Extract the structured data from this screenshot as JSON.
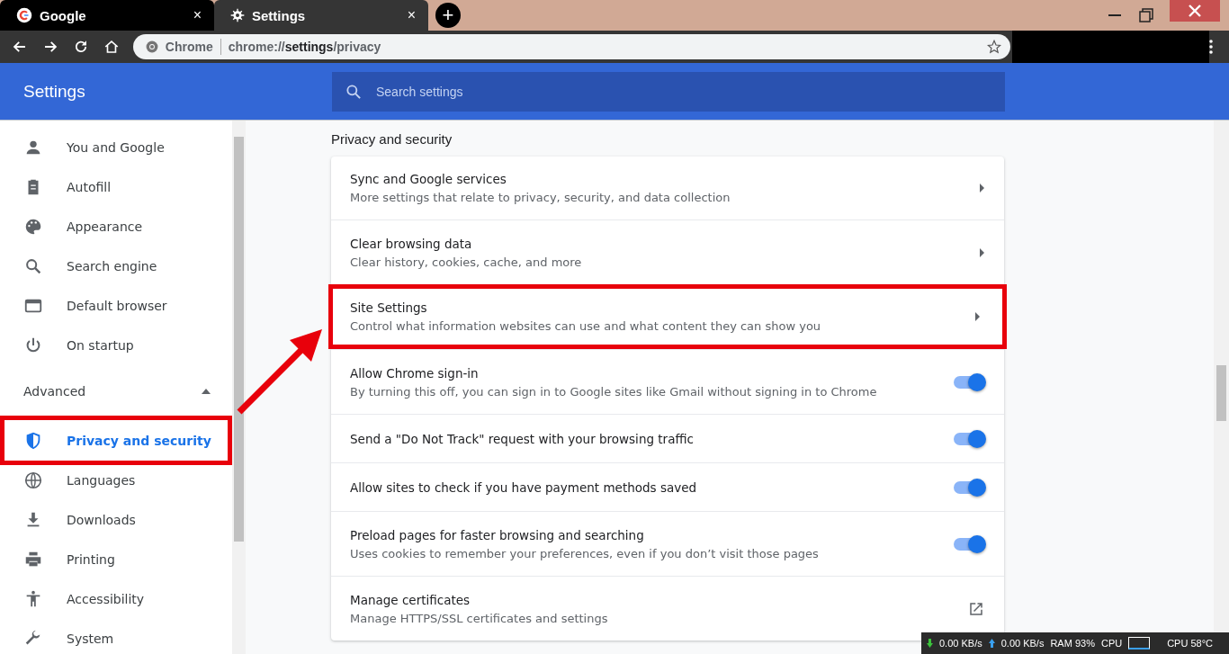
{
  "tabs": [
    {
      "title": "Google",
      "selected": false,
      "close": "×"
    },
    {
      "title": "Settings",
      "selected": true,
      "close": "×"
    }
  ],
  "new_tab": "+",
  "address_bar": {
    "site_label": "Chrome",
    "url_prefix": "chrome://",
    "url_bold": "settings",
    "url_suffix": "/privacy"
  },
  "header": {
    "title": "Settings",
    "search_placeholder": "Search settings"
  },
  "sidebar": {
    "items": [
      {
        "label": "You and Google",
        "selected": false,
        "highlighted": false
      },
      {
        "label": "Autofill",
        "selected": false,
        "highlighted": false
      },
      {
        "label": "Appearance",
        "selected": false,
        "highlighted": false
      },
      {
        "label": "Search engine",
        "selected": false,
        "highlighted": false
      },
      {
        "label": "Default browser",
        "selected": false,
        "highlighted": false
      },
      {
        "label": "On startup",
        "selected": false,
        "highlighted": false
      }
    ],
    "advanced": {
      "label": "Advanced",
      "expanded": true
    },
    "advanced_items": [
      {
        "label": "Privacy and security",
        "selected": true,
        "highlighted": true
      },
      {
        "label": "Languages",
        "selected": false,
        "highlighted": false
      },
      {
        "label": "Downloads",
        "selected": false,
        "highlighted": false
      },
      {
        "label": "Printing",
        "selected": false,
        "highlighted": false
      },
      {
        "label": "Accessibility",
        "selected": false,
        "highlighted": false
      },
      {
        "label": "System",
        "selected": false,
        "highlighted": false
      }
    ]
  },
  "section": {
    "title": "Privacy and security",
    "rows": [
      {
        "kind": "arrow",
        "title": "Sync and Google services",
        "subtitle": "More settings that relate to privacy, security, and data collection",
        "highlighted": false
      },
      {
        "kind": "arrow",
        "title": "Clear browsing data",
        "subtitle": "Clear history, cookies, cache, and more",
        "highlighted": false
      },
      {
        "kind": "arrow",
        "title": "Site Settings",
        "subtitle": "Control what information websites can use and what content they can show you",
        "highlighted": true
      },
      {
        "kind": "toggle",
        "title": "Allow Chrome sign-in",
        "subtitle": "By turning this off, you can sign in to Google sites like Gmail without signing in to Chrome",
        "on": true,
        "highlighted": false
      },
      {
        "kind": "toggle",
        "title": "Send a \"Do Not Track\" request with your browsing traffic",
        "on": true,
        "highlighted": false
      },
      {
        "kind": "toggle",
        "title": "Allow sites to check if you have payment methods saved",
        "on": true,
        "highlighted": false
      },
      {
        "kind": "toggle",
        "title": "Preload pages for faster browsing and searching",
        "subtitle": "Uses cookies to remember your preferences, even if you don’t visit those pages",
        "on": true,
        "highlighted": false
      },
      {
        "kind": "external",
        "title": "Manage certificates",
        "subtitle": "Manage HTTPS/SSL certificates and settings",
        "highlighted": false
      }
    ]
  },
  "monitor": {
    "download": "0.00 KB/s",
    "upload": "0.00 KB/s",
    "ram": "RAM 93%",
    "cpu_label": "CPU",
    "cpu_temp": "CPU 58°C"
  }
}
